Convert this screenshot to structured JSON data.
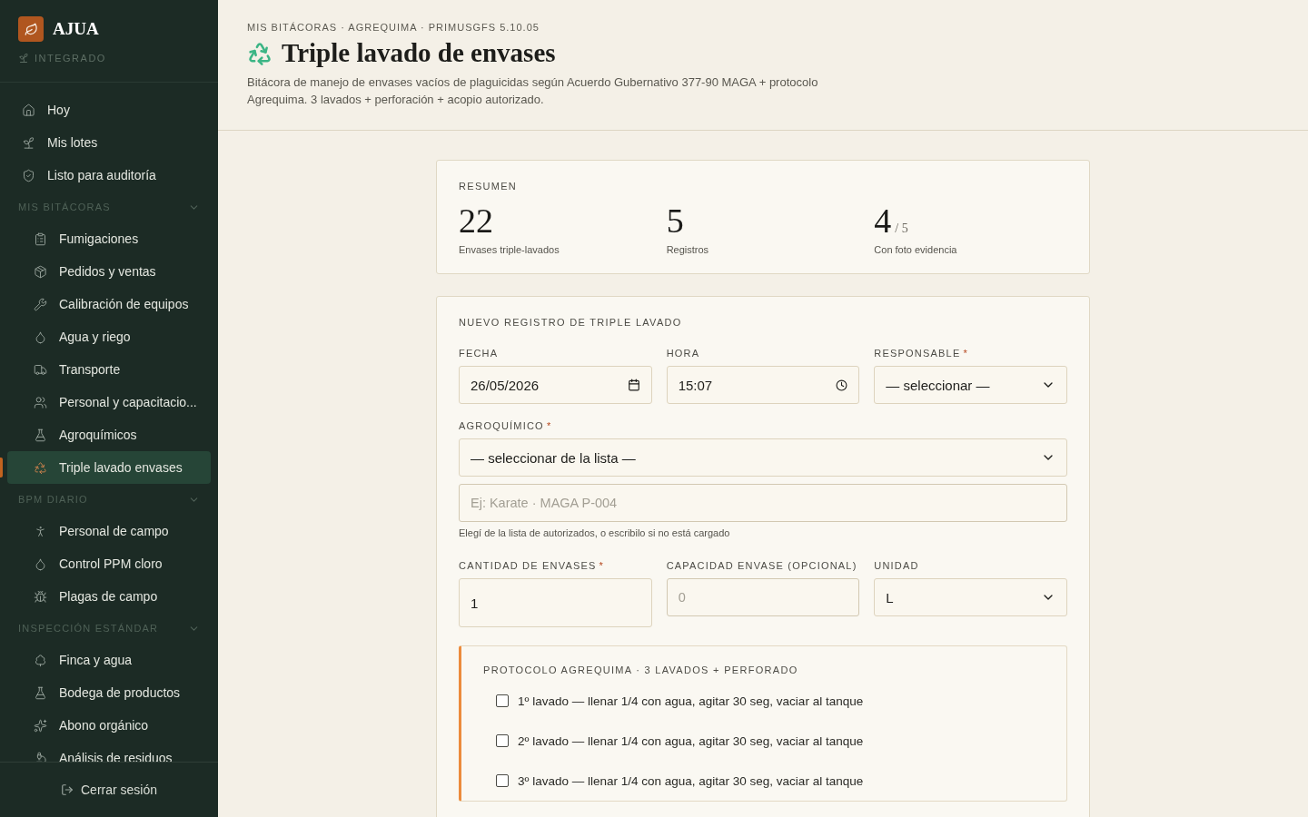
{
  "brand": {
    "name": "AJUA",
    "subtitle": "INTEGRADO"
  },
  "nav": [
    {
      "label": "Hoy",
      "selected": false
    },
    {
      "label": "Mis lotes",
      "selected": false
    },
    {
      "label": "Listo para auditoría",
      "selected": false
    }
  ],
  "groups": [
    {
      "title": "MIS BITÁCORAS",
      "expanded": true,
      "items": [
        {
          "label": "Fumigaciones",
          "selected": false
        },
        {
          "label": "Pedidos y ventas",
          "selected": false
        },
        {
          "label": "Calibración de equipos",
          "selected": false
        },
        {
          "label": "Agua y riego",
          "selected": false
        },
        {
          "label": "Transporte",
          "selected": false
        },
        {
          "label": "Personal y capacitacio...",
          "selected": false
        },
        {
          "label": "Agroquímicos",
          "selected": false
        },
        {
          "label": "Triple lavado envases",
          "selected": true
        }
      ]
    },
    {
      "title": "BPM DIARIO",
      "expanded": true,
      "items": [
        {
          "label": "Personal de campo",
          "selected": false
        },
        {
          "label": "Control PPM cloro",
          "selected": false
        },
        {
          "label": "Plagas de campo",
          "selected": false
        }
      ]
    },
    {
      "title": "INSPECCIÓN ESTÁNDAR",
      "expanded": true,
      "items": [
        {
          "label": "Finca y agua",
          "selected": false
        },
        {
          "label": "Bodega de productos",
          "selected": false
        },
        {
          "label": "Abono orgánico",
          "selected": false
        },
        {
          "label": "Análisis de residuos",
          "selected": false
        }
      ]
    }
  ],
  "logout": "Cerrar sesión",
  "header": {
    "breadcrumb": "MIS BITÁCORAS · AGREQUIMA · PRIMUSGFS 5.10.05",
    "title": "Triple lavado de envases",
    "description": "Bitácora de manejo de envases vacíos de plaguicidas según Acuerdo Gubernativo 377-90 MAGA + protocolo Agrequima. 3 lavados + perforación + acopio autorizado."
  },
  "summary": {
    "title": "RESUMEN",
    "stats": [
      {
        "value": "22",
        "label": "Envases triple-lavados"
      },
      {
        "value": "5",
        "label": "Registros"
      },
      {
        "value": "4",
        "total": "/ 5",
        "label": "Con foto evidencia"
      }
    ]
  },
  "form": {
    "title": "NUEVO REGISTRO DE TRIPLE LAVADO",
    "row1": [
      {
        "kind": "date",
        "label": "FECHA",
        "value": "26/05/2026"
      },
      {
        "kind": "time",
        "label": "HORA",
        "value": "15:07"
      },
      {
        "kind": "select",
        "label": "RESPONSABLE",
        "required_mark": "*",
        "value": "— seleccionar —"
      }
    ],
    "agro": {
      "label": "AGROQUÍMICO",
      "required_mark": "*",
      "select": "— seleccionar de la lista —",
      "placeholder": "Ej: Karate · MAGA P-004",
      "hint": "Elegí de la lista de autorizados, o escribilo si no está cargado"
    },
    "row2": [
      {
        "kind": "number",
        "label": "CANTIDAD DE ENVASES",
        "required_mark": "*",
        "value": "1"
      },
      {
        "kind": "text",
        "label": "CAPACIDAD ENVASE (OPCIONAL)",
        "placeholder": "0"
      },
      {
        "kind": "select",
        "label": "UNIDAD",
        "value": "L"
      }
    ],
    "protocol": {
      "title": "PROTOCOLO AGREQUIMA · 3 LAVADOS + PERFORADO",
      "steps": [
        {
          "label": "1º lavado — llenar 1/4 con agua, agitar 30 seg, vaciar al tanque",
          "checked": false
        },
        {
          "label": "2º lavado — llenar 1/4 con agua, agitar 30 seg, vaciar al tanque",
          "checked": false
        },
        {
          "label": "3º lavado — llenar 1/4 con agua, agitar 30 seg, vaciar al tanque",
          "checked": false
        }
      ]
    }
  }
}
